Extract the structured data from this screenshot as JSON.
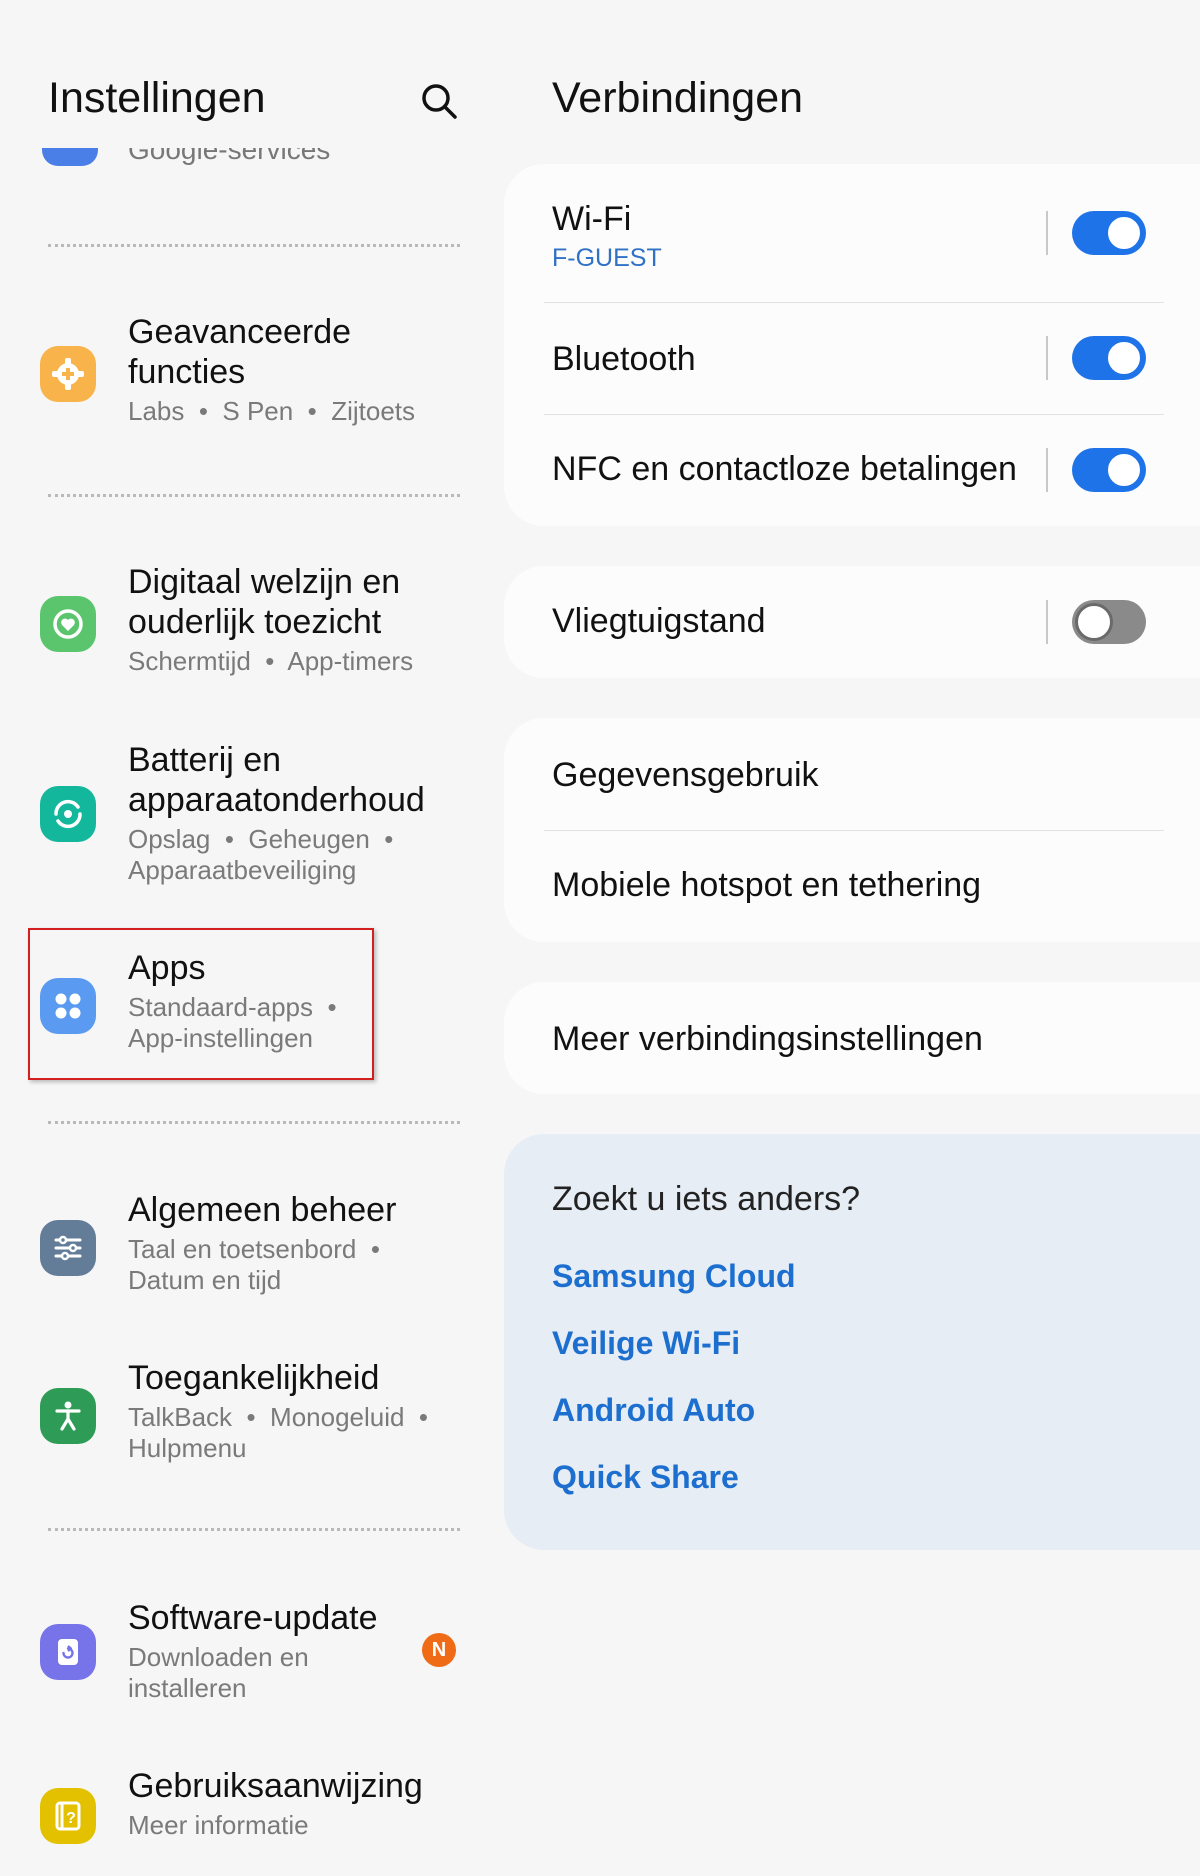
{
  "left": {
    "title": "Instellingen",
    "partial_item": "Google-services",
    "items": [
      {
        "title_lines": [
          "Geavanceerde",
          "functies"
        ],
        "sub_lines": [
          "Labs  •  S Pen  •  Zijtoets"
        ],
        "icon": "gear-plus-icon",
        "color": "#f8b34a"
      },
      {
        "title_lines": [
          "Digitaal welzijn en",
          "ouderlijk toezicht"
        ],
        "sub_lines": [
          "Schermtijd  •  App-timers"
        ],
        "icon": "heart-circle-icon",
        "color": "#5bc56e"
      },
      {
        "title_lines": [
          "Batterij en",
          "apparaatonderhoud"
        ],
        "sub_lines": [
          "Opslag  •  Geheugen  •",
          "Apparaatbeveiliging"
        ],
        "icon": "device-care-icon",
        "color": "#13b79c"
      },
      {
        "title_lines": [
          "Apps"
        ],
        "sub_lines": [
          "Standaard-apps  •",
          "App-instellingen"
        ],
        "icon": "apps-grid-icon",
        "color": "#5a9af0"
      },
      {
        "title_lines": [
          "Algemeen beheer"
        ],
        "sub_lines": [
          "Taal en toetsenbord  •",
          "Datum en tijd"
        ],
        "icon": "sliders-icon",
        "color": "#637d99"
      },
      {
        "title_lines": [
          "Toegankelijkheid"
        ],
        "sub_lines": [
          "TalkBack  •  Monogeluid  •",
          "Hulpmenu"
        ],
        "icon": "accessibility-icon",
        "color": "#2e9b57"
      },
      {
        "title_lines": [
          "Software-update"
        ],
        "sub_lines": [
          "Downloaden en",
          "installeren"
        ],
        "icon": "software-update-icon",
        "color": "#7773e8",
        "badge": "N"
      },
      {
        "title_lines": [
          "Gebruiksaanwijzing"
        ],
        "sub_lines": [
          "Meer informatie"
        ],
        "icon": "user-manual-icon",
        "color": "#e4c100"
      }
    ]
  },
  "right": {
    "title": "Verbindingen",
    "wifi": {
      "label": "Wi-Fi",
      "network": "F-GUEST",
      "on": true
    },
    "bluetooth": {
      "label": "Bluetooth",
      "on": true
    },
    "nfc": {
      "label": "NFC en contactloze betalingen",
      "on": true
    },
    "airplane": {
      "label": "Vliegtuigstand",
      "on": false
    },
    "data_usage": "Gegevensgebruik",
    "hotspot": "Mobiele hotspot en tethering",
    "more": "Meer verbindingsinstellingen",
    "suggestions": {
      "title": "Zoekt u iets anders?",
      "links": [
        "Samsung Cloud",
        "Veilige Wi-Fi",
        "Android Auto",
        "Quick Share"
      ]
    }
  },
  "colors": {
    "accent": "#1f73e8",
    "link": "#1d6fcf",
    "highlight": "#d21f1f",
    "badge": "#ef6b16"
  }
}
